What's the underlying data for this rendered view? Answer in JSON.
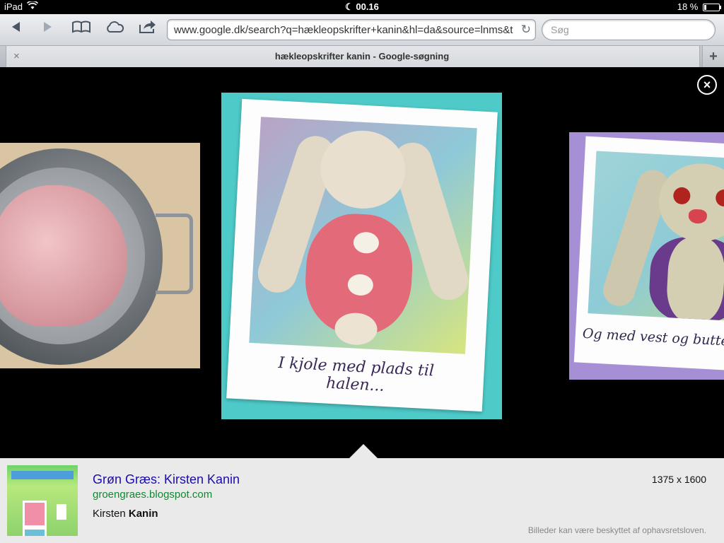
{
  "status_bar": {
    "device": "iPad",
    "time": "00.16",
    "battery": "18 %",
    "battery_level_percent": 18
  },
  "toolbar": {
    "back_icon": "back-arrow-icon",
    "forward_icon": "forward-arrow-icon",
    "bookmarks_icon": "bookmarks-book-icon",
    "icloud_icon": "cloud-icon",
    "share_icon": "share-icon",
    "url": "www.google.dk/search?q=hækleopskrifter+kanin&hl=da&source=lnms&t",
    "search_placeholder": "Søg"
  },
  "tab": {
    "title": "hækleopskrifter kanin - Google-søgning",
    "close": "×",
    "new_tab": "+"
  },
  "viewer": {
    "center_caption": "I kjole med plads til halen...",
    "right_caption": "Og med vest og butter"
  },
  "info": {
    "title": "Grøn Græs: Kirsten Kanin",
    "url": "groengraes.blogspot.com",
    "desc_prefix": "Kirsten ",
    "desc_bold": "Kanin",
    "dimensions": "1375 x 1600",
    "copyright_note": "Billeder kan være beskyttet af ophavsretsloven."
  }
}
